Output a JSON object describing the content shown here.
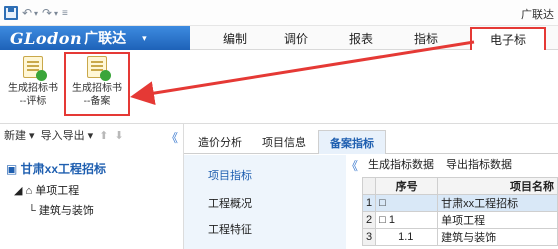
{
  "titlebar": {
    "app_title": "广联达",
    "icons": [
      "save-icon",
      "undo-icon",
      "redo-icon",
      "customize-icon"
    ]
  },
  "brand": {
    "logo": "GLodon",
    "name": "广联达",
    "arrow": "▾"
  },
  "menu": {
    "items": [
      "编制",
      "调价",
      "报表",
      "指标"
    ],
    "active": "电子标"
  },
  "ribbon": {
    "buttons": [
      {
        "line1": "生成招标书",
        "line2": "--评标"
      },
      {
        "line1": "生成招标书",
        "line2": "--备案"
      }
    ]
  },
  "leftpane": {
    "toolbar": {
      "new": "新建 ▾",
      "import_export": "导入导出 ▾",
      "up": "⬆",
      "down": "⬇",
      "collapse": "《"
    },
    "tree": {
      "root": "甘肃xx工程招标",
      "child": "单项工程",
      "grandchild": "建筑与装饰"
    }
  },
  "tabs": {
    "items": [
      "造价分析",
      "项目信息",
      "备案指标"
    ],
    "active_index": 2,
    "collapse": "《"
  },
  "subnav": {
    "items": [
      "项目指标",
      "工程概况",
      "工程特征"
    ],
    "active_index": 0
  },
  "grid": {
    "toolbar": [
      "生成指标数据",
      "导出指标数据"
    ],
    "headers": {
      "seq": "序号",
      "name": "项目名称"
    },
    "rows": [
      {
        "rn": "1",
        "seq": "□",
        "name": "甘肃xx工程招标"
      },
      {
        "rn": "2",
        "seq": "□ 1",
        "name": "单项工程"
      },
      {
        "rn": "3",
        "seq": "1.1",
        "name": "建筑与装饰"
      }
    ]
  },
  "colors": {
    "brand_blue": "#1e62b8",
    "highlight_red": "#e53935",
    "link_blue": "#1f5fb0"
  }
}
